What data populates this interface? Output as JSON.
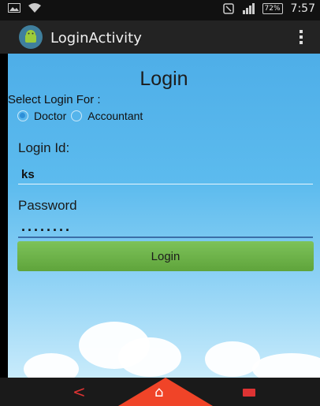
{
  "status_bar": {
    "battery": "72%",
    "time": "7:57"
  },
  "action_bar": {
    "title": "LoginActivity"
  },
  "form": {
    "heading": "Login",
    "select_label": "Select Login For :",
    "options": [
      {
        "label": "Doctor",
        "selected": true
      },
      {
        "label": "Accountant",
        "selected": false
      }
    ],
    "login_id_label": "Login Id:",
    "login_id_value": "ks",
    "password_label": "Password",
    "password_value": "........",
    "submit_label": "Login"
  },
  "colors": {
    "background_sky": "#5cbbee",
    "button_green": "#6bb246",
    "home_button": "#f04428"
  },
  "nav_bar": {
    "back_icon": "back-icon",
    "home_icon": "home-icon",
    "recent_icon": "recent-apps-icon"
  }
}
